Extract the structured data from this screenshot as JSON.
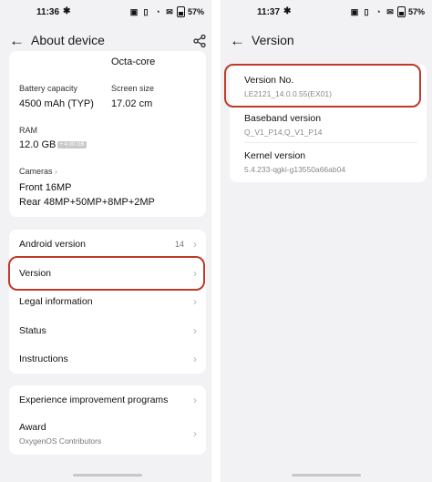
{
  "left": {
    "status": {
      "time": "11:36",
      "battery": "57%"
    },
    "header": {
      "title": "About device"
    },
    "specs": {
      "cpu_value": "Octa-core",
      "battery_label": "Battery capacity",
      "battery_value": "4500 mAh (TYP)",
      "screen_label": "Screen size",
      "screen_value": "17.02 cm",
      "ram_label": "RAM",
      "ram_value": "12.0 GB",
      "ram_badge": "+ 4.00 GB",
      "cameras_label": "Cameras",
      "camera_front": "Front 16MP",
      "camera_rear": "Rear 48MP+50MP+8MP+2MP"
    },
    "menu": [
      {
        "label": "Android version",
        "value": "14"
      },
      {
        "label": "Version"
      },
      {
        "label": "Legal information"
      },
      {
        "label": "Status"
      },
      {
        "label": "Instructions"
      }
    ],
    "menu2": [
      {
        "label": "Experience improvement programs"
      },
      {
        "label": "Award",
        "sub": "OxygenOS Contributors"
      }
    ]
  },
  "right": {
    "status": {
      "time": "11:37",
      "battery": "57%"
    },
    "header": {
      "title": "Version"
    },
    "items": [
      {
        "label": "Version No.",
        "value": "LE2121_14.0.0.55(EX01)"
      },
      {
        "label": "Baseband version",
        "value": "Q_V1_P14,Q_V1_P14"
      },
      {
        "label": "Kernel version",
        "value": "5.4.233-qgki-g13550a66ab04"
      }
    ]
  },
  "highlight_color": "#c0392b",
  "icons": [
    "gear-icon",
    "nfc-icon",
    "vibrate-icon",
    "wifi-icon",
    "mail-icon",
    "battery-icon",
    "back-arrow-icon",
    "share-icon",
    "chevron-right-icon"
  ]
}
